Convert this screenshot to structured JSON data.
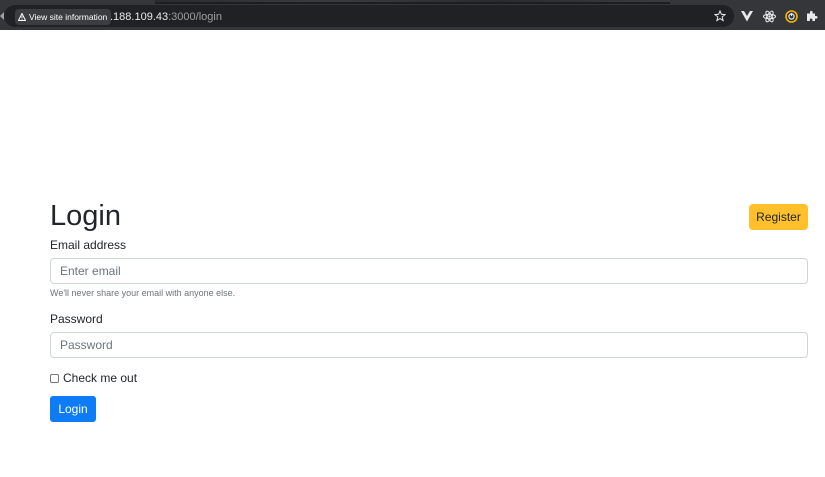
{
  "browser": {
    "site_info_label": "View site information",
    "url_host": ".188.109.43",
    "url_rest": ":3000/login",
    "toolbar_icons": [
      "star-icon",
      "vue-devtools-icon",
      "react-devtools-icon",
      "extension-circle-icon",
      "extensions-puzzle-icon"
    ]
  },
  "page": {
    "title": "Login",
    "register_label": "Register",
    "email": {
      "label": "Email address",
      "placeholder": "Enter email",
      "value": "",
      "help": "We'll never share your email with anyone else."
    },
    "password": {
      "label": "Password",
      "placeholder": "Password",
      "value": ""
    },
    "remember": {
      "label": "Check me out",
      "checked": false
    },
    "login_label": "Login"
  },
  "colors": {
    "register_button": "#ffc02c",
    "login_button": "#0d7cf6",
    "chrome_bar": "#35363a"
  }
}
